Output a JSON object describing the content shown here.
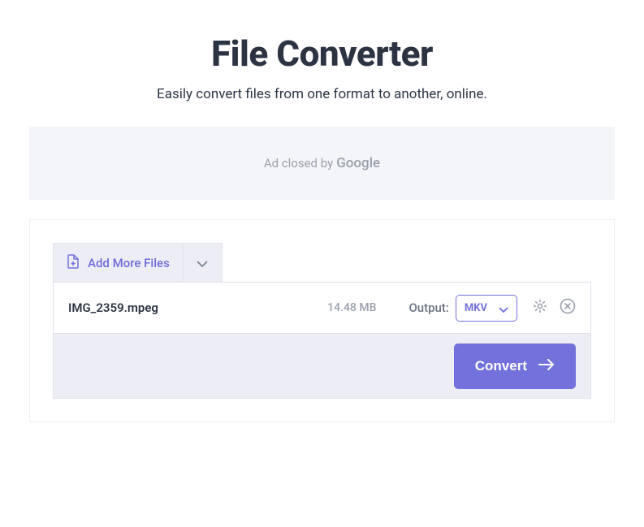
{
  "header": {
    "title": "File Converter",
    "subtitle": "Easily convert files from one format to another, online."
  },
  "ad": {
    "text": "Ad closed by",
    "brand": "Google"
  },
  "toolbar": {
    "add_files_label": "Add More Files"
  },
  "files": [
    {
      "name": "IMG_2359.mpeg",
      "size": "14.48 MB",
      "output_label": "Output:",
      "output_format": "MKV"
    }
  ],
  "actions": {
    "convert_label": "Convert"
  },
  "colors": {
    "accent": "#7371db",
    "text_dark": "#2c3444",
    "text_muted": "#9aa0ac",
    "panel_bg": "#edeef5"
  }
}
